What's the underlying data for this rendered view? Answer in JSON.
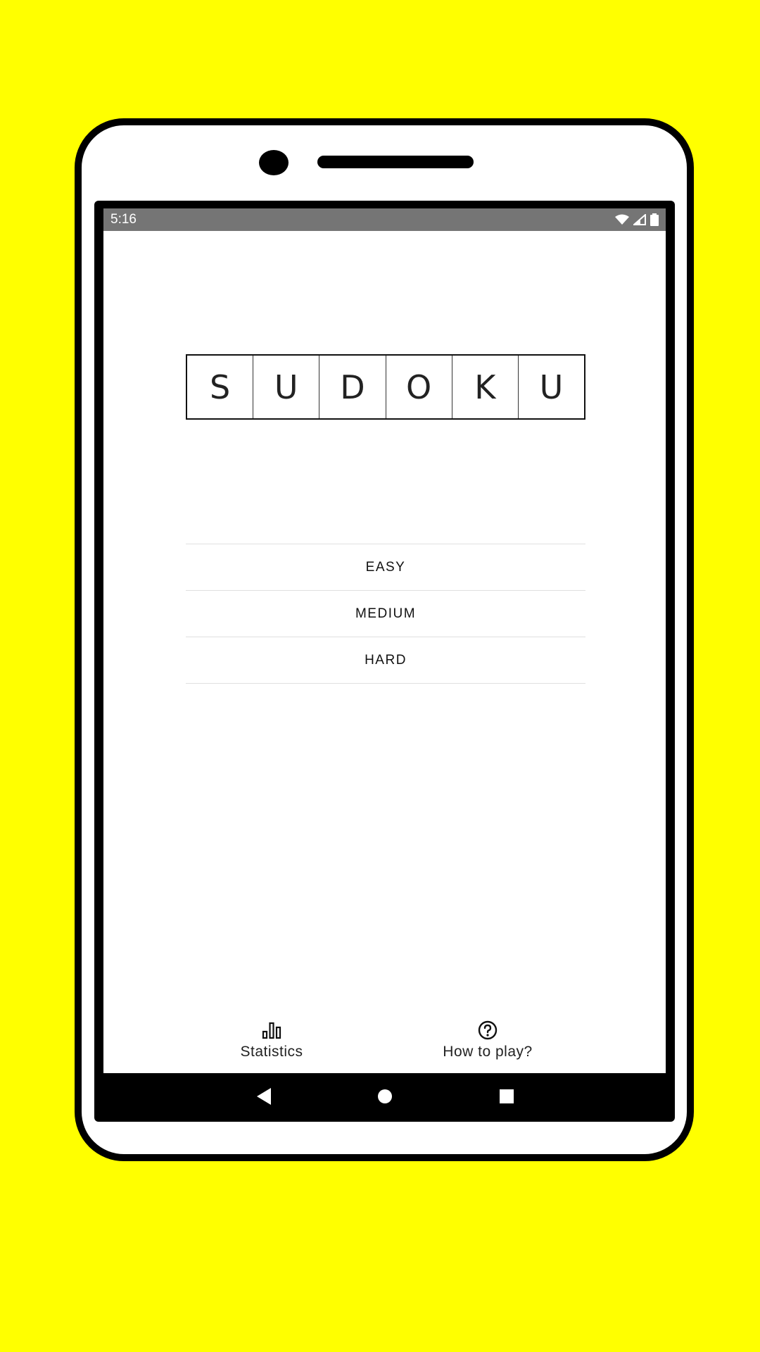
{
  "status_bar": {
    "time": "5:16",
    "icons": [
      "wifi-icon",
      "cell-signal-icon",
      "battery-icon"
    ]
  },
  "title_letters": [
    "S",
    "U",
    "D",
    "O",
    "K",
    "U"
  ],
  "difficulty": {
    "easy": "EASY",
    "medium": "MEDIUM",
    "hard": "HARD"
  },
  "bottom_actions": {
    "statistics": {
      "label": "Statistics",
      "icon": "bar-chart-icon"
    },
    "how_to_play": {
      "label": "How to play?",
      "icon": "help-circle-icon"
    }
  },
  "nav_bar": {
    "icons": [
      "back-icon",
      "home-icon",
      "recents-icon"
    ]
  },
  "colors": {
    "background": "#ffff00",
    "status_bar": "#757575",
    "divider": "#e0e0e0"
  }
}
